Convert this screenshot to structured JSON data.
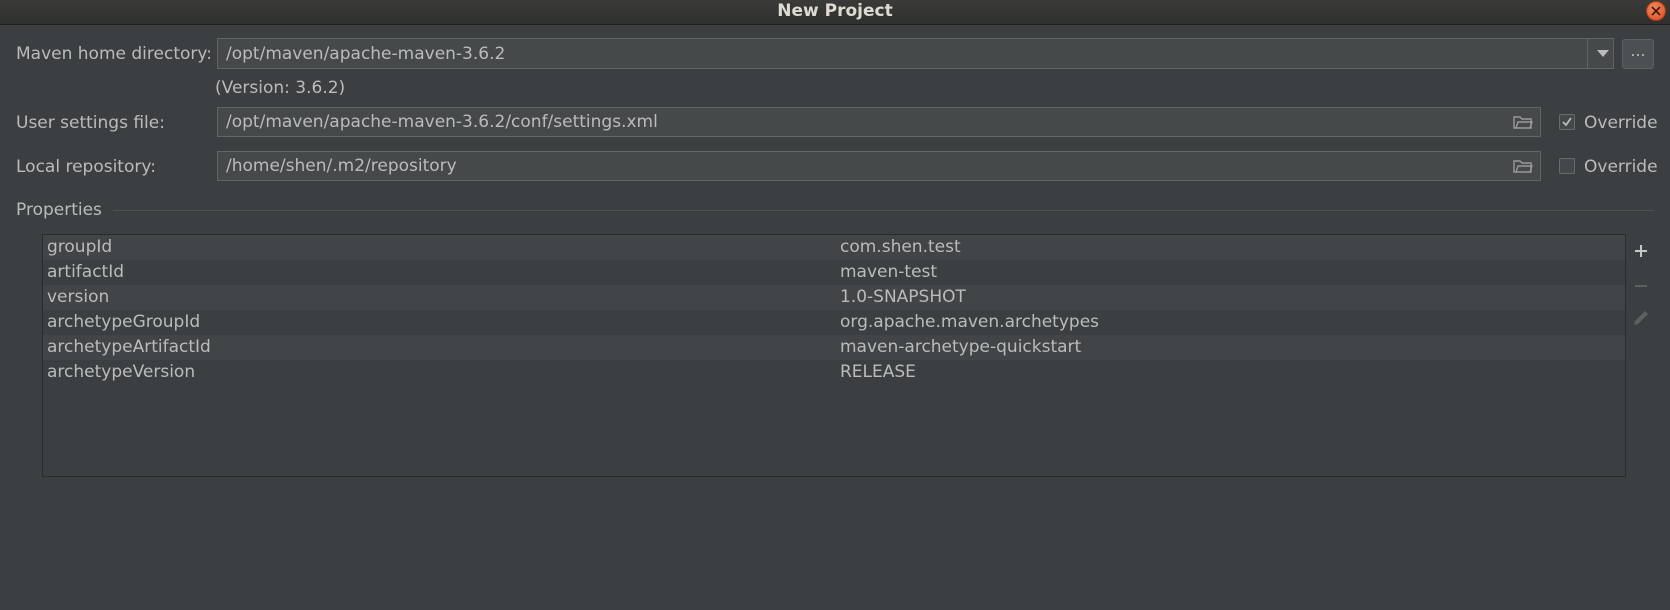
{
  "window": {
    "title": "New Project"
  },
  "maven_home": {
    "label": "Maven home directory:",
    "value": "/opt/maven/apache-maven-3.6.2",
    "browse_label": "...",
    "version_note": "(Version: 3.6.2)"
  },
  "user_settings": {
    "label": "User settings file:",
    "value": "/opt/maven/apache-maven-3.6.2/conf/settings.xml",
    "override_label": "Override",
    "override_checked": true
  },
  "local_repo": {
    "label": "Local repository:",
    "value": "/home/shen/.m2/repository",
    "override_label": "Override",
    "override_checked": false
  },
  "properties": {
    "title": "Properties",
    "rows": [
      {
        "key": "groupId",
        "value": "com.shen.test"
      },
      {
        "key": "artifactId",
        "value": "maven-test"
      },
      {
        "key": "version",
        "value": "1.0-SNAPSHOT"
      },
      {
        "key": "archetypeGroupId",
        "value": "org.apache.maven.archetypes"
      },
      {
        "key": "archetypeArtifactId",
        "value": "maven-archetype-quickstart"
      },
      {
        "key": "archetypeVersion",
        "value": "RELEASE"
      }
    ],
    "tools": [
      "add-icon",
      "remove-icon",
      "edit-icon"
    ]
  }
}
